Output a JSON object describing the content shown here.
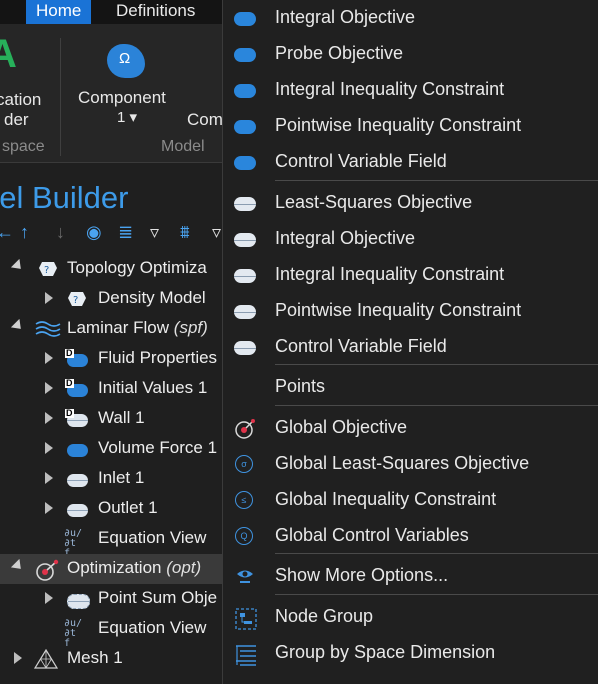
{
  "ribbon": {
    "tabs": [
      "Home",
      "Definitions"
    ],
    "app_icon_glyph": "A",
    "left_button_lines": [
      "cation",
      "der"
    ],
    "workspace_group": "space",
    "component_label": "Component",
    "component_value": "1 ▾",
    "component_glyph": "Ω",
    "partial_label": "Com",
    "model_group": "Model"
  },
  "model_builder": {
    "title": "del Builder",
    "tree": [
      {
        "label": "Topology Optimiza",
        "tag": "",
        "icon": "topology-optimization-icon"
      },
      {
        "label": "Density Model",
        "tag": "",
        "icon": "density-model-icon"
      },
      {
        "label": "Laminar Flow",
        "tag": "(spf)",
        "icon": "laminar-flow-icon"
      },
      {
        "label": "Fluid Properties",
        "tag": "",
        "icon": "fluid-properties-icon"
      },
      {
        "label": "Initial Values 1",
        "tag": "",
        "icon": "initial-values-icon"
      },
      {
        "label": "Wall 1",
        "tag": "",
        "icon": "wall-icon"
      },
      {
        "label": "Volume Force 1",
        "tag": "",
        "icon": "volume-force-icon"
      },
      {
        "label": "Inlet 1",
        "tag": "",
        "icon": "inlet-icon"
      },
      {
        "label": "Outlet 1",
        "tag": "",
        "icon": "outlet-icon"
      },
      {
        "label": "Equation View",
        "tag": "",
        "icon": "equation-view-icon"
      },
      {
        "label": "Optimization",
        "tag": "(opt)",
        "icon": "optimization-icon"
      },
      {
        "label": "Point Sum Obje",
        "tag": "",
        "icon": "point-sum-objective-icon"
      },
      {
        "label": "Equation View",
        "tag": "",
        "icon": "equation-view-icon"
      },
      {
        "label": "Mesh 1",
        "tag": "",
        "icon": "mesh-icon"
      }
    ],
    "equation_glyph": "∂u/∂t f",
    "d_badge": "D"
  },
  "menu": {
    "items": [
      {
        "label": "Integral Objective",
        "icon": "domain-integral-objective-icon"
      },
      {
        "label": "Probe Objective",
        "icon": "domain-probe-objective-icon"
      },
      {
        "label": "Integral Inequality Constraint",
        "icon": "domain-integral-inequality-constraint-icon"
      },
      {
        "label": "Pointwise Inequality Constraint",
        "icon": "domain-pointwise-inequality-constraint-icon"
      },
      {
        "label": "Control Variable Field",
        "icon": "domain-control-variable-field-icon"
      },
      {
        "label": "Least-Squares Objective",
        "icon": "boundary-least-squares-objective-icon"
      },
      {
        "label": "Integral Objective",
        "icon": "boundary-integral-objective-icon"
      },
      {
        "label": "Integral Inequality Constraint",
        "icon": "boundary-integral-inequality-constraint-icon"
      },
      {
        "label": "Pointwise Inequality Constraint",
        "icon": "boundary-pointwise-inequality-constraint-icon"
      },
      {
        "label": "Control Variable Field",
        "icon": "boundary-control-variable-field-icon"
      },
      {
        "label": "Points",
        "icon": ""
      },
      {
        "label": "Global Objective",
        "icon": "global-objective-icon"
      },
      {
        "label": "Global Least-Squares Objective",
        "icon": "global-least-squares-objective-icon"
      },
      {
        "label": "Global Inequality Constraint",
        "icon": "global-inequality-constraint-icon"
      },
      {
        "label": "Global Control Variables",
        "icon": "global-control-variables-icon"
      },
      {
        "label": "Show More Options...",
        "icon": "show-more-options-icon"
      },
      {
        "label": "Node Group",
        "icon": "node-group-icon"
      },
      {
        "label": "Group by Space Dimension",
        "icon": "group-by-space-dimension-icon"
      }
    ],
    "glyphs": {
      "least_squares": "σ",
      "inequality": "≤",
      "control": "Q"
    }
  },
  "colors": {
    "accent": "#1a73d6",
    "title_blue": "#3d9be9",
    "icon_blue": "#2a86dc",
    "optimization_red": "#e0334a"
  }
}
